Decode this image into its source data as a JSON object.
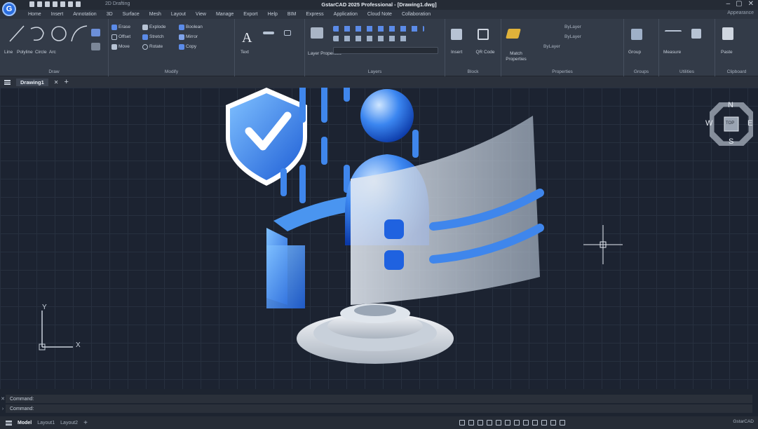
{
  "app": {
    "logo_letter": "G",
    "workspace": "2D Drafting",
    "title": "GstarCAD 2025 Professional - [Drawing1.dwg]",
    "win_min": "–",
    "win_restore": "▢",
    "win_close": "✕"
  },
  "menu": {
    "items": [
      "Home",
      "Insert",
      "Annotation",
      "3D",
      "Surface",
      "Mesh",
      "Layout",
      "View",
      "Manage",
      "Export",
      "Help",
      "BIM",
      "Express",
      "Application",
      "Cloud Note",
      "Collaboration"
    ],
    "right": "Appearance"
  },
  "ribbon": {
    "draw": {
      "caption": "Draw",
      "tools": [
        "Line",
        "Polyline",
        "Circle",
        "Arc"
      ]
    },
    "modify": {
      "caption": "Modify",
      "rows": [
        [
          "Erase",
          "Explode",
          "Boolean"
        ],
        [
          "Offset",
          "Stretch",
          "Mirror"
        ],
        [
          "Move",
          "Rotate",
          "Copy"
        ]
      ]
    },
    "annotation": {
      "text_label": "Text"
    },
    "layers": {
      "caption": "Layers",
      "properties_label": "Layer Properties"
    },
    "block": {
      "caption": "Block",
      "insert_label": "Insert",
      "qr_label": "QR Code"
    },
    "properties": {
      "caption": "Properties",
      "match_label": "Match Properties",
      "bylayer": [
        "ByLayer",
        "ByLayer",
        "ByLayer"
      ]
    },
    "groups": {
      "caption": "Groups",
      "group_label": "Group"
    },
    "utilities": {
      "caption": "Utilities",
      "measure_label": "Measure"
    },
    "clipboard": {
      "caption": "Clipboard",
      "paste_label": "Paste"
    }
  },
  "tabs": {
    "document": "Drawing1",
    "close": "✕",
    "add": "+"
  },
  "viewcube": {
    "n": "N",
    "s": "S",
    "e": "E",
    "w": "W",
    "top": "TOP"
  },
  "ucs": {
    "x": "X",
    "y": "Y"
  },
  "command": {
    "line1": "Command:",
    "line2": "Command:"
  },
  "status": {
    "model": "Model",
    "layouts": [
      "Layout1",
      "Layout2"
    ],
    "add": "+",
    "right": "GstarCAD"
  },
  "colors": {
    "accent": "#2b6ee0",
    "canvas": "#1c2331",
    "ribbon": "#333b48"
  }
}
